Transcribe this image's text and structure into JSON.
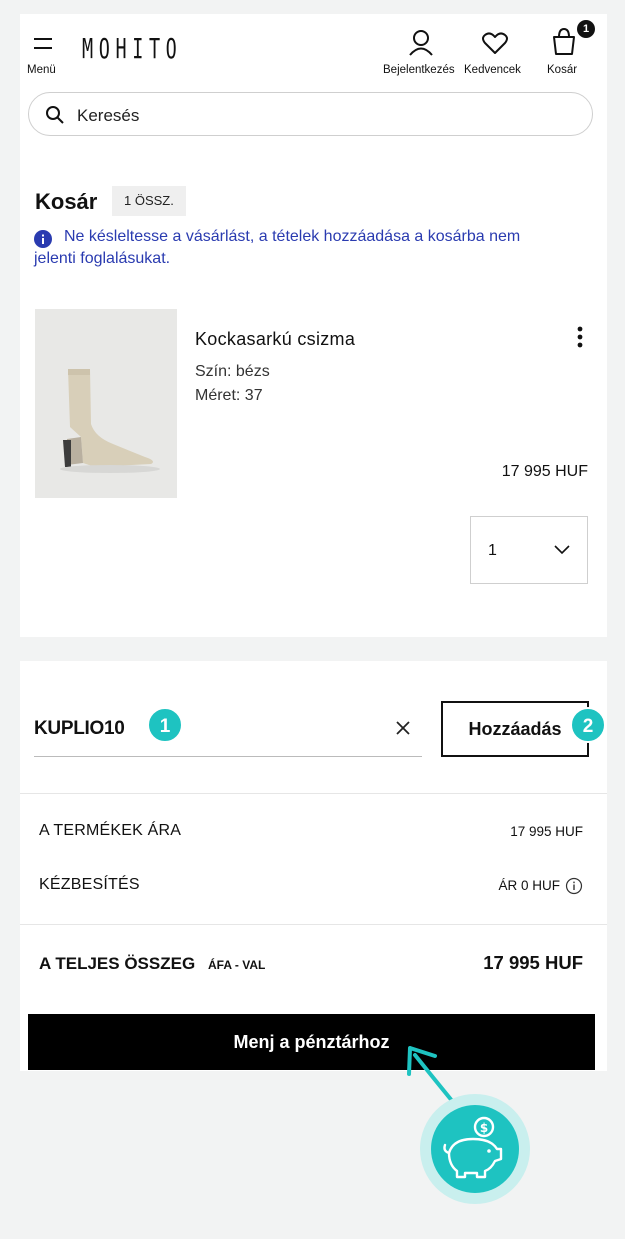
{
  "header": {
    "menu_label": "Menü",
    "logo_text": "MOHITO",
    "login_label": "Bejelentkezés",
    "favorites_label": "Kedvencek",
    "cart_label": "Kosár",
    "cart_count": "1"
  },
  "search": {
    "placeholder": "Keresés"
  },
  "cart": {
    "title": "Kosár",
    "count_badge": "1 ÖSSZ.",
    "info_text": "Ne késleltesse a vásárlást, a tételek hozzáadása a kosárba nem jelenti foglalásukat."
  },
  "item": {
    "name": "Kockasarkú csizma",
    "color": "Szín: bézs",
    "size": "Méret: 37",
    "price": "17 995 HUF",
    "quantity": "1"
  },
  "coupon": {
    "code": "KUPLIO10",
    "apply_label": "Hozzáadás",
    "step1": "1",
    "step2": "2"
  },
  "summary": {
    "products_label": "A TERMÉKEK ÁRA",
    "products_value": "17 995 HUF",
    "delivery_label": "KÉZBESÍTÉS",
    "delivery_value": "ÁR 0 HUF",
    "total_label": "A TELJES ÖSSZEG",
    "total_suffix": "ÁFA - VAL",
    "total_value": "17 995 HUF"
  },
  "checkout": {
    "label": "Menj a pénztárhoz"
  },
  "colors": {
    "accent": "#1ec3c1",
    "info_text": "#2a3bb0",
    "button_bg": "#000000"
  }
}
